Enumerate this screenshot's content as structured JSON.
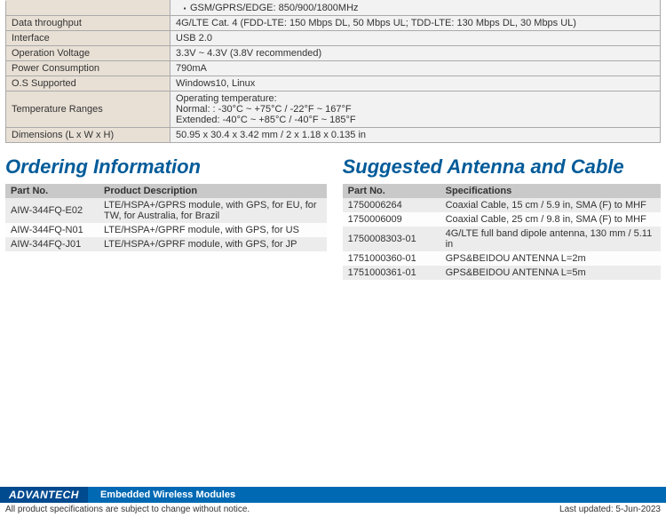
{
  "spec_rows": [
    {
      "label": "",
      "value_type": "bullet",
      "value": "GSM/GPRS/EDGE: 850/900/1800MHz",
      "label_hidden": true
    },
    {
      "label": "Data throughput",
      "value": "4G/LTE Cat. 4 (FDD-LTE: 150 Mbps DL, 50 Mbps UL; TDD-LTE: 130 Mbps DL, 30 Mbps UL)"
    },
    {
      "label": "Interface",
      "value": "USB 2.0"
    },
    {
      "label": "Operation Voltage",
      "value": "3.3V ~ 4.3V (3.8V recommended)"
    },
    {
      "label": "Power Consumption",
      "value": "790mA"
    },
    {
      "label": "O.S Supported",
      "value": "Windows10, Linux"
    },
    {
      "label": "Temperature Ranges",
      "value_type": "multi",
      "lines": [
        "Operating temperature:",
        "Normal: : -30°C ~ +75°C / -22°F ~ 167°F",
        "Extended: -40°C ~ +85°C / -40°F ~ 185°F"
      ]
    },
    {
      "label": "Dimensions (L x W x H)",
      "value": "50.95 x 30.4 x 3.42 mm / 2 x 1.18 x 0.135 in"
    }
  ],
  "ordering": {
    "title": "Ordering Information",
    "headers": {
      "c1": "Part No.",
      "c2": "Product Description"
    },
    "rows": [
      {
        "c1": "AIW-344FQ-E02",
        "c2": "LTE/HSPA+/GPRS module, with GPS, for EU, for TW, for Australia, for Brazil"
      },
      {
        "c1": "AIW-344FQ-N01",
        "c2": "LTE/HSPA+/GPRF module, with GPS, for US"
      },
      {
        "c1": "AIW-344FQ-J01",
        "c2": "LTE/HSPA+/GPRF module, with GPS, for JP"
      }
    ]
  },
  "antenna": {
    "title": "Suggested Antenna and Cable",
    "headers": {
      "c1": "Part No.",
      "c2": "Specifications"
    },
    "rows": [
      {
        "c1": "1750006264",
        "c2": "Coaxial Cable, 15 cm / 5.9 in, SMA (F) to MHF"
      },
      {
        "c1": "1750006009",
        "c2": "Coaxial Cable, 25 cm / 9.8 in, SMA (F) to MHF"
      },
      {
        "c1": "1750008303-01",
        "c2": "4G/LTE full band dipole antenna, 130 mm / 5.11 in"
      },
      {
        "c1": "1751000360-01",
        "c2": "GPS&BEIDOU ANTENNA L=2m"
      },
      {
        "c1": "1751000361-01",
        "c2": "GPS&BEIDOU ANTENNA L=5m"
      }
    ]
  },
  "footer": {
    "brand": "ADVANTECH",
    "category": "Embedded Wireless Modules",
    "disclaimer": "All product specifications are subject to change without notice.",
    "updated": "Last updated: 5-Jun-2023"
  }
}
